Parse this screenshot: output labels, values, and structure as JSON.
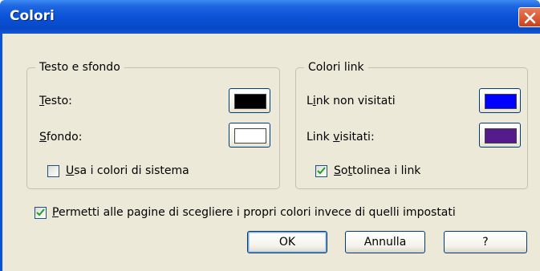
{
  "window": {
    "title": "Colori"
  },
  "text_bg_group": {
    "legend": "Testo e sfondo",
    "text_label_u": "T",
    "text_label_rest": "esto:",
    "text_color": "#000000",
    "bg_label_u": "S",
    "bg_label_rest": "fondo:",
    "bg_color": "#ffffff",
    "system_colors_u": "U",
    "system_colors_rest": "sa i colori di sistema",
    "system_colors_checked": false
  },
  "link_group": {
    "legend": "Colori link",
    "unvisited_pre": "L",
    "unvisited_u": "i",
    "unvisited_post": "nk non visitati",
    "unvisited_color": "#0000ff",
    "visited_pre": "Link ",
    "visited_u": "v",
    "visited_post": "isitati:",
    "visited_color": "#551a8b",
    "underline_u": "S",
    "underline_mid": "o",
    "underline_u2": "t",
    "underline_rest": "tolinea i link",
    "underline_checked": true
  },
  "allow_pages": {
    "label_u": "P",
    "label_rest": "ermetti alle pagine di scegliere i propri colori invece di quelli impostati",
    "checked": true
  },
  "buttons": {
    "ok": "OK",
    "cancel": "Annulla",
    "help": "?"
  }
}
